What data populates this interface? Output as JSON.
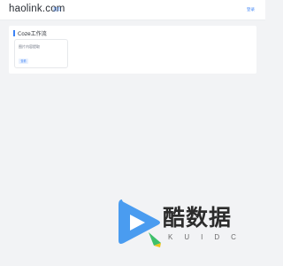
{
  "header": {
    "site_name": "haolink.com",
    "left_link": "首页",
    "right_link": "登录"
  },
  "section": {
    "title": "Coze工作流",
    "card": {
      "text": "图片内容提取",
      "tag": "查看"
    }
  },
  "watermark": {
    "name_cn": "酷数据",
    "name_en": "KUIDC",
    "logo": "play-logo",
    "colors": {
      "blue": "#4a9cf0",
      "green": "#3ec06a",
      "yellow": "#f0c419"
    }
  }
}
